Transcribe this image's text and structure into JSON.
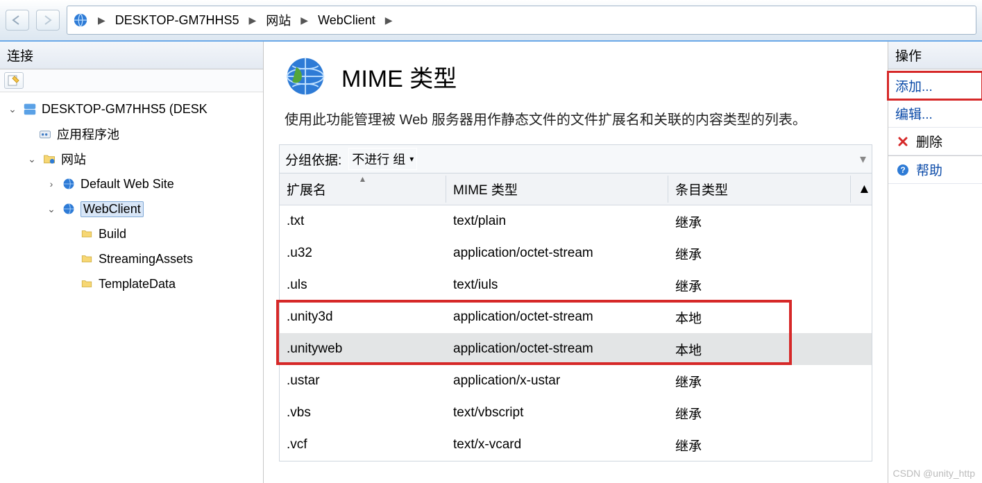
{
  "breadcrumbs": [
    "DESKTOP-GM7HHS5",
    "网站",
    "WebClient"
  ],
  "left": {
    "title": "连接",
    "root": "DESKTOP-GM7HHS5 (DESK",
    "appPools": "应用程序池",
    "sites": "网站",
    "defaultSite": "Default Web Site",
    "webclient": "WebClient",
    "children": [
      "Build",
      "StreamingAssets",
      "TemplateData"
    ]
  },
  "middle": {
    "title": "MIME 类型",
    "description": "使用此功能管理被 Web 服务器用作静态文件的文件扩展名和关联的内容类型的列表。",
    "groupLabel": "分组依据:",
    "groupValue": "不进行    组",
    "headers": [
      "扩展名",
      "MIME 类型",
      "条目类型"
    ],
    "rows": [
      {
        "ext": ".txt",
        "mime": "text/plain",
        "entry": "继承"
      },
      {
        "ext": ".u32",
        "mime": "application/octet-stream",
        "entry": "继承"
      },
      {
        "ext": ".uls",
        "mime": "text/iuls",
        "entry": "继承"
      },
      {
        "ext": ".unity3d",
        "mime": "application/octet-stream",
        "entry": "本地"
      },
      {
        "ext": ".unityweb",
        "mime": "application/octet-stream",
        "entry": "本地"
      },
      {
        "ext": ".ustar",
        "mime": "application/x-ustar",
        "entry": "继承"
      },
      {
        "ext": ".vbs",
        "mime": "text/vbscript",
        "entry": "继承"
      },
      {
        "ext": ".vcf",
        "mime": "text/x-vcard",
        "entry": "继承"
      }
    ]
  },
  "right": {
    "title": "操作",
    "add": "添加...",
    "edit": "编辑...",
    "delete": "删除",
    "help": "帮助"
  },
  "watermark": "CSDN @unity_http"
}
